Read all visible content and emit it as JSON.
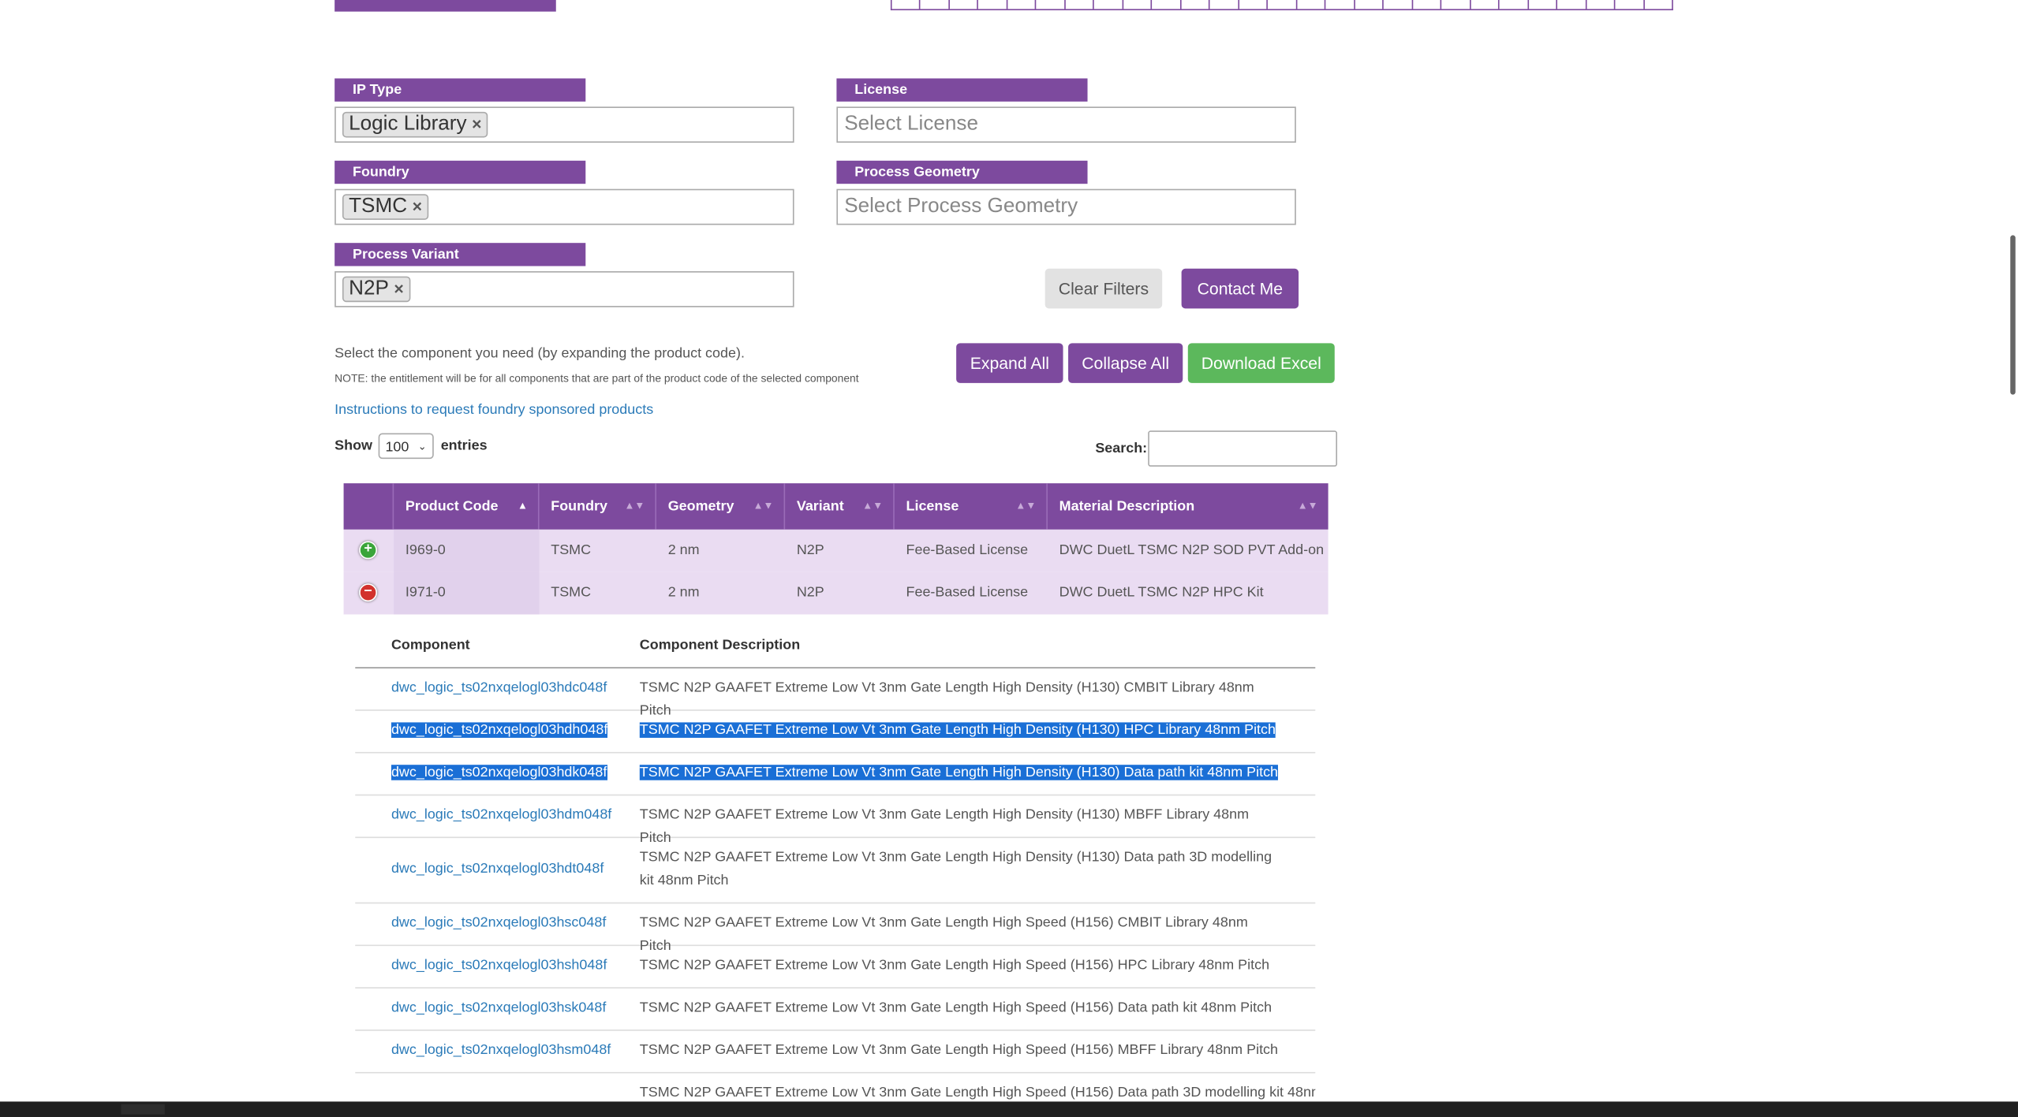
{
  "filters": {
    "ip_type": {
      "label": "IP Type",
      "chip": "Logic Library"
    },
    "license": {
      "label": "License",
      "placeholder": "Select License"
    },
    "foundry": {
      "label": "Foundry",
      "chip": "TSMC"
    },
    "process_geometry": {
      "label": "Process Geometry",
      "placeholder": "Select Process Geometry"
    },
    "process_variant": {
      "label": "Process Variant",
      "chip": "N2P"
    },
    "chip_remove_glyph": "×"
  },
  "buttons": {
    "clear_filters": "Clear Filters",
    "contact_me": "Contact Me",
    "expand_all": "Expand All",
    "collapse_all": "Collapse All",
    "download_excel": "Download Excel"
  },
  "notes": {
    "select_component": "Select the component you need (by expanding the product code).",
    "entitlement": "NOTE: the entitlement will be for all components that are part of the product code of the selected component",
    "instructions_link": "Instructions to request foundry sponsored products"
  },
  "table_controls": {
    "show": "Show",
    "entries_value": "100",
    "entries": "entries",
    "search": "Search:"
  },
  "main_table": {
    "headers": [
      "Product Code",
      "Foundry",
      "Geometry",
      "Variant",
      "License",
      "Material Description"
    ],
    "rows": [
      {
        "expanded": false,
        "product_code": "I969-0",
        "foundry": "TSMC",
        "geometry": "2 nm",
        "variant": "N2P",
        "license": "Fee-Based License",
        "description": "DWC DuetL TSMC N2P SOD PVT Add-on"
      },
      {
        "expanded": true,
        "product_code": "I971-0",
        "foundry": "TSMC",
        "geometry": "2 nm",
        "variant": "N2P",
        "license": "Fee-Based License",
        "description": "DWC DuetL TSMC N2P HPC Kit"
      }
    ]
  },
  "component_table": {
    "headers": [
      "Component",
      "Component Description"
    ],
    "rows": [
      {
        "component": "dwc_logic_ts02nxqelogl03hdc048f",
        "description": "TSMC N2P GAAFET Extreme Low Vt 3nm Gate Length High Density (H130) CMBIT Library 48nm Pitch",
        "selected": false
      },
      {
        "component": "dwc_logic_ts02nxqelogl03hdh048f",
        "description": "TSMC N2P GAAFET Extreme Low Vt 3nm Gate Length High Density (H130) HPC Library 48nm Pitch",
        "selected": true
      },
      {
        "component": "dwc_logic_ts02nxqelogl03hdk048f",
        "description": "TSMC N2P GAAFET Extreme Low Vt 3nm Gate Length High Density (H130) Data path kit 48nm Pitch",
        "selected": true
      },
      {
        "component": "dwc_logic_ts02nxqelogl03hdm048f",
        "description": "TSMC N2P GAAFET Extreme Low Vt 3nm Gate Length High Density (H130) MBFF Library 48nm Pitch",
        "selected": false
      },
      {
        "component": "dwc_logic_ts02nxqelogl03hdt048f",
        "description": "TSMC N2P GAAFET Extreme Low Vt 3nm Gate Length High Density (H130) Data path 3D modelling kit 48nm Pitch",
        "selected": false
      },
      {
        "component": "dwc_logic_ts02nxqelogl03hsc048f",
        "description": "TSMC N2P GAAFET Extreme Low Vt 3nm Gate Length High Speed (H156) CMBIT Library 48nm Pitch",
        "selected": false
      },
      {
        "component": "dwc_logic_ts02nxqelogl03hsh048f",
        "description": "TSMC N2P GAAFET Extreme Low Vt 3nm Gate Length High Speed (H156) HPC Library 48nm Pitch",
        "selected": false
      },
      {
        "component": "dwc_logic_ts02nxqelogl03hsk048f",
        "description": "TSMC N2P GAAFET Extreme Low Vt 3nm Gate Length High Speed (H156) Data path kit 48nm Pitch",
        "selected": false
      },
      {
        "component": "dwc_logic_ts02nxqelogl03hsm048f",
        "description": "TSMC N2P GAAFET Extreme Low Vt 3nm Gate Length High Speed (H156) MBFF Library 48nm Pitch",
        "selected": false
      },
      {
        "component": "",
        "description": "TSMC N2P GAAFET Extreme Low Vt 3nm Gate Length High Speed (H156) Data path 3D modelling kit 48nm",
        "selected": false
      }
    ]
  },
  "colors": {
    "brand_purple": "#7d4a9e",
    "row_tint": "#eadcf2",
    "link_blue": "#2a7ab8",
    "download_green": "#5cb85c",
    "selection_blue": "#1a6fd6"
  }
}
